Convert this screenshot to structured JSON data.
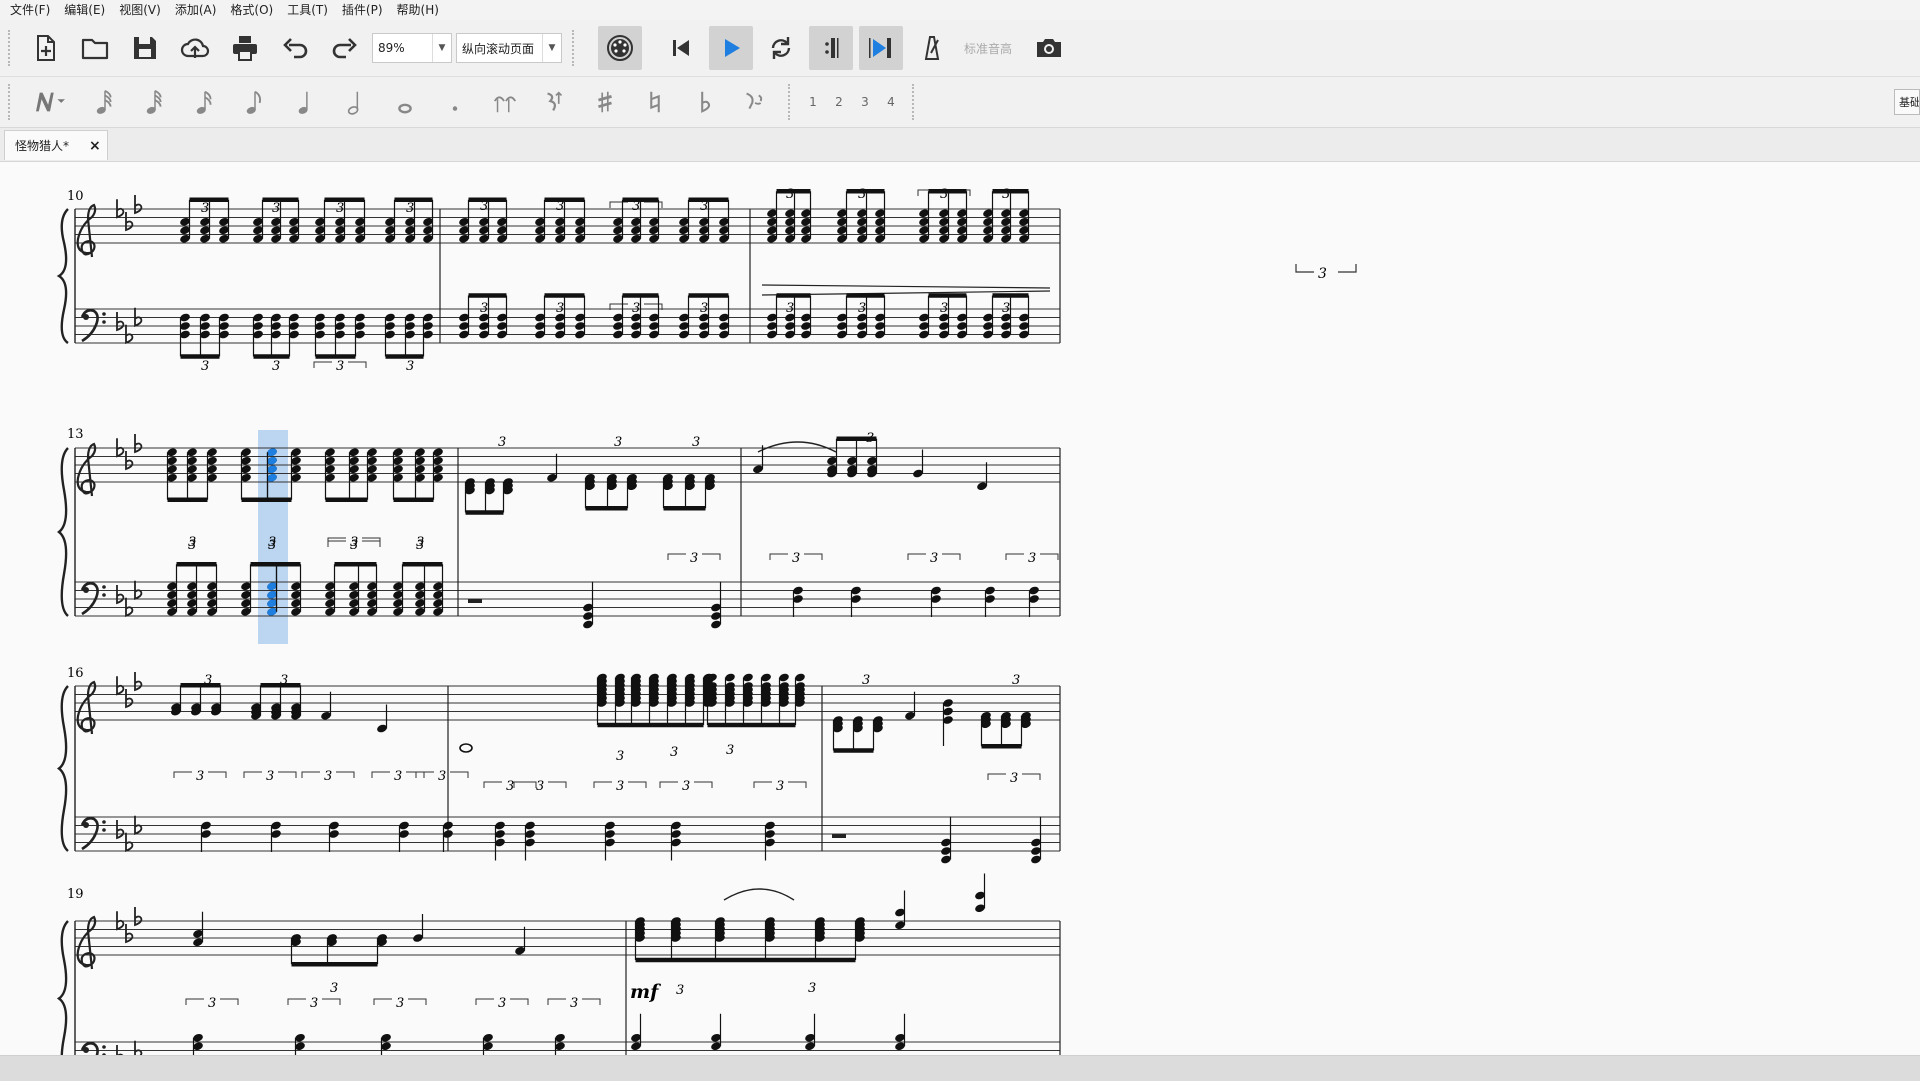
{
  "menu": [
    "文件(F)",
    "编辑(E)",
    "视图(V)",
    "添加(A)",
    "格式(O)",
    "工具(T)",
    "插件(P)",
    "帮助(H)"
  ],
  "toolbar": {
    "zoom_value": "89%",
    "view_mode_value": "纵向滚动页面",
    "concert_pitch_label": "标准音高",
    "basic_label": "基础"
  },
  "note_input": {
    "voices": [
      "1",
      "2",
      "3",
      "4"
    ]
  },
  "tabs": [
    {
      "label": "怪物猎人*",
      "close": "×"
    }
  ],
  "score": {
    "measure_numbers": [
      "10",
      "13",
      "16",
      "19"
    ],
    "dynamic_mark": "mf",
    "tuplet_digit": "3"
  },
  "colors": {
    "selection": "#bcd6f2",
    "selected_note": "#1f7fe0",
    "accent_play": "#1f7fe0"
  }
}
